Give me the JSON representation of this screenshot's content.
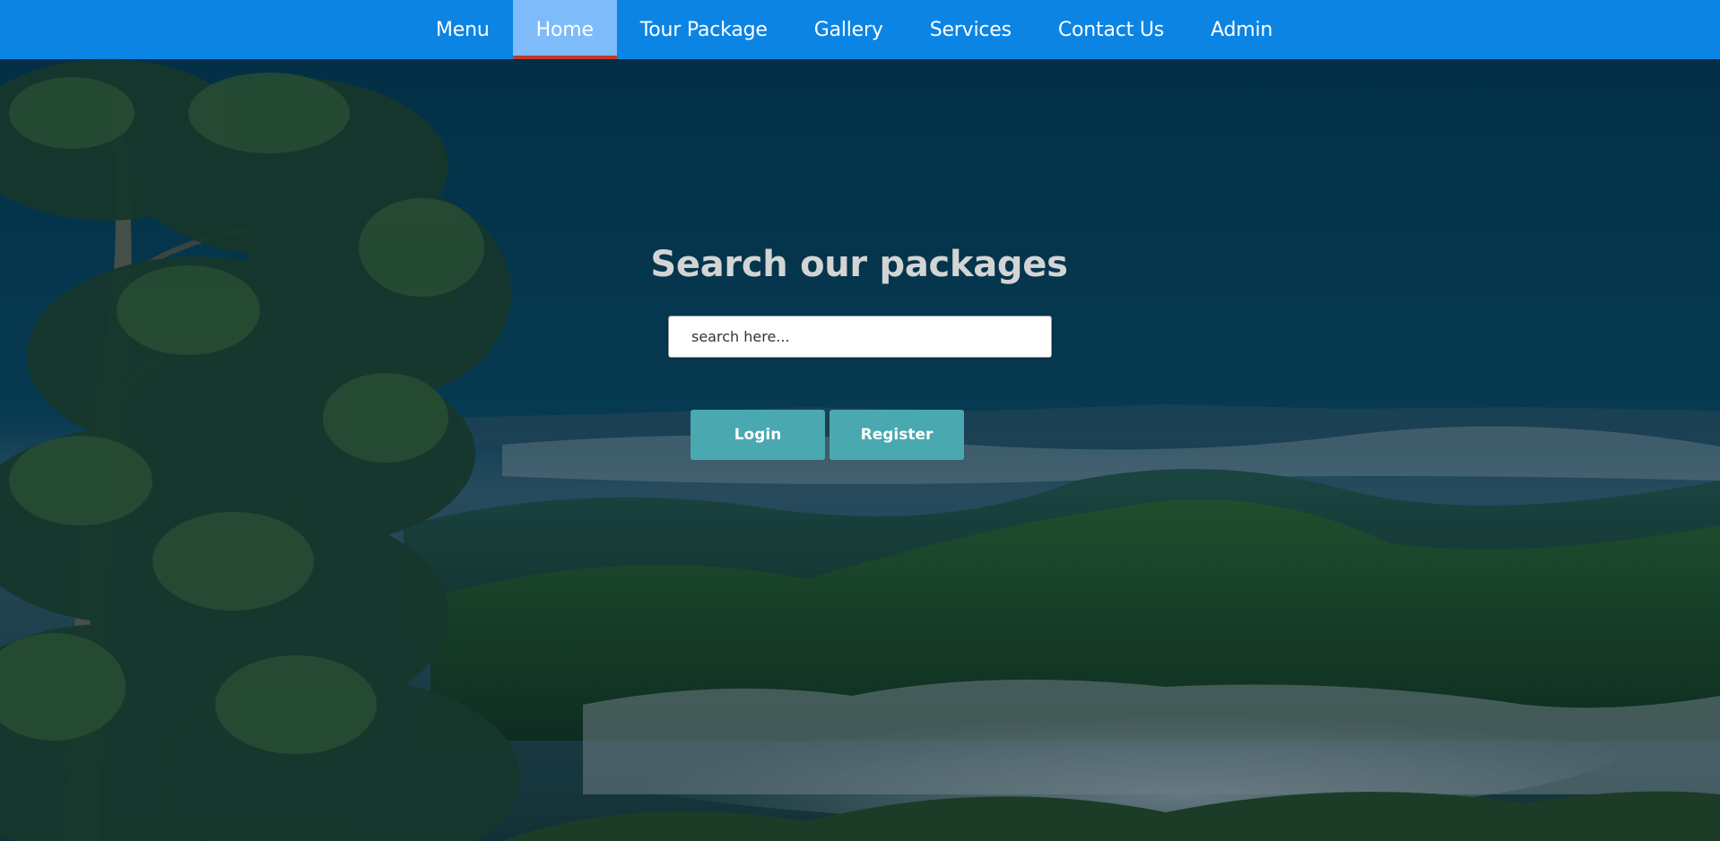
{
  "nav": {
    "items": [
      {
        "label": "Menu",
        "active": false
      },
      {
        "label": "Home",
        "active": true
      },
      {
        "label": "Tour Package",
        "active": false
      },
      {
        "label": "Gallery",
        "active": false
      },
      {
        "label": "Services",
        "active": false
      },
      {
        "label": "Contact Us",
        "active": false
      },
      {
        "label": "Admin",
        "active": false
      }
    ]
  },
  "hero": {
    "title": "Search our packages",
    "search": {
      "value": "",
      "placeholder": "search here..."
    },
    "buttons": {
      "login": "Login",
      "register": "Register"
    }
  },
  "colors": {
    "navbar": "#0b84e4",
    "nav_active_bg": "#7dbbfb",
    "nav_active_underline": "#c0392b",
    "button": "#4aa8b0",
    "title": "#d4d4d4"
  }
}
